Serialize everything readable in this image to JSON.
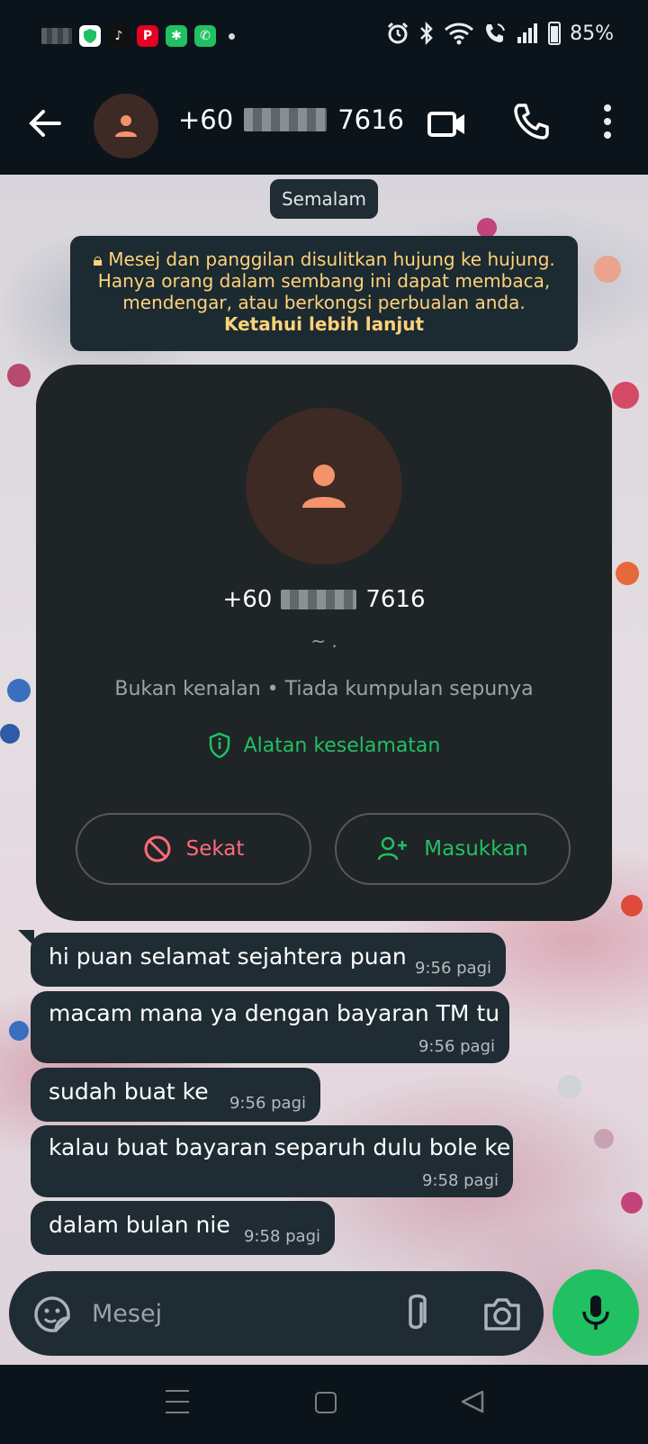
{
  "status_bar": {
    "battery_percent": "85%",
    "icons": [
      "alarm-icon",
      "bluetooth-icon",
      "wifi-icon",
      "wifi-calling-icon",
      "signal-icon",
      "battery-icon"
    ],
    "app_icons": [
      "security-app-icon",
      "tiktok-icon",
      "pinterest-icon",
      "app-icon",
      "phone-app-icon"
    ]
  },
  "header": {
    "number_prefix": "+60",
    "number_suffix": "7616",
    "icons": [
      "back-arrow-icon",
      "person-icon",
      "video-call-icon",
      "phone-call-icon",
      "more-vert-icon"
    ]
  },
  "chat": {
    "date_chip": "Semalam",
    "encryption_notice": {
      "text": "Mesej dan panggilan disulitkan hujung ke hujung. Hanya orang dalam sembang ini dapat membaca, mendengar, atau berkongsi perbualan anda.",
      "link": "Ketahui lebih lanjut"
    },
    "contact_card": {
      "number_prefix": "+60",
      "number_suffix": "7616",
      "tilde": "~ .",
      "subtitle": "Bukan kenalan • Tiada kumpulan sepunya",
      "safety_tools": "Alatan keselamatan",
      "block_label": "Sekat",
      "add_label": "Masukkan"
    },
    "messages": [
      {
        "text": "hi puan selamat sejahtera puan",
        "time": "9:56 pagi"
      },
      {
        "text": "macam mana ya dengan bayaran TM tu",
        "time": "9:56 pagi"
      },
      {
        "text": "sudah buat ke",
        "time": "9:56 pagi"
      },
      {
        "text": "kalau buat bayaran separuh dulu bole ke",
        "time": "9:58 pagi"
      },
      {
        "text": "dalam bulan nie",
        "time": "9:58 pagi"
      }
    ]
  },
  "composer": {
    "placeholder": "Mesej"
  },
  "colors": {
    "accent_green": "#21c063",
    "notice_yellow": "#ffd279",
    "block_red": "#ff6b7a",
    "bubble": "#1f2c33",
    "bar_bg": "#0b141a"
  }
}
